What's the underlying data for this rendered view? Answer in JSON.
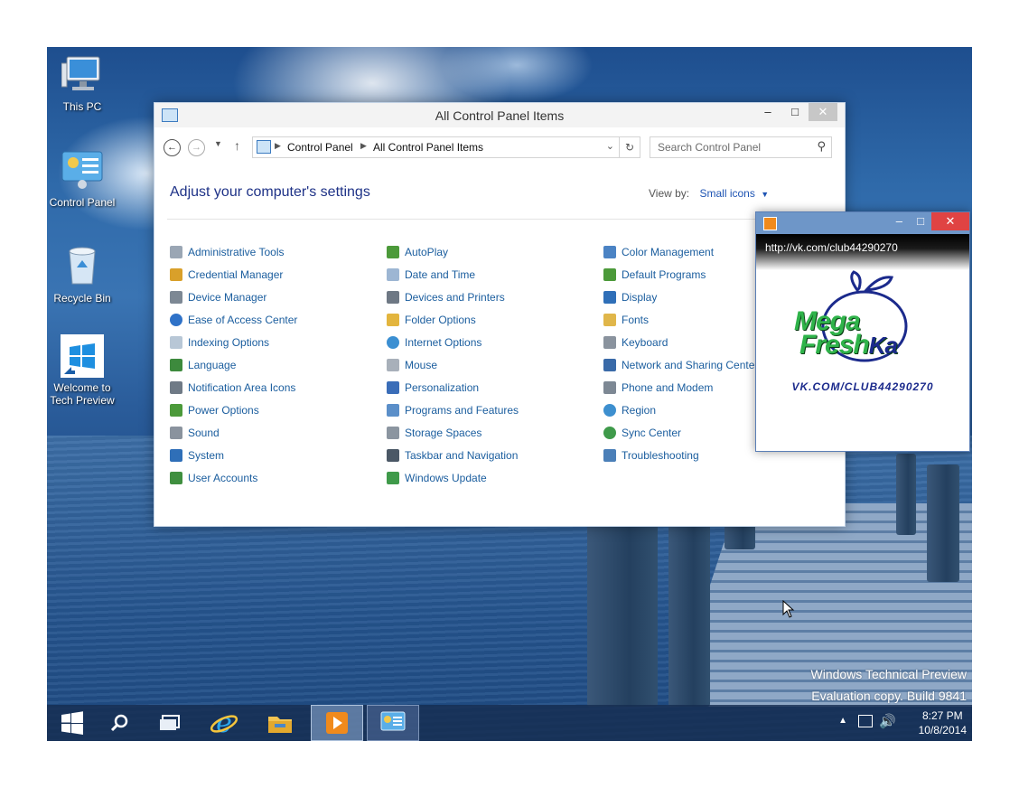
{
  "desktop": {
    "icons": [
      {
        "label": "This PC",
        "icon": "computer-icon"
      },
      {
        "label": "Control Panel",
        "icon": "control-panel-icon"
      },
      {
        "label": "Recycle Bin",
        "icon": "recycle-bin-icon"
      },
      {
        "label_line1": "Welcome to",
        "label_line2": "Tech Preview",
        "icon": "windows-logo-icon"
      }
    ],
    "watermark_line1": "Windows Technical Preview",
    "watermark_line2": "Evaluation copy. Build 9841"
  },
  "control_panel": {
    "title": "All Control Panel Items",
    "breadcrumb": [
      "Control Panel",
      "All Control Panel Items"
    ],
    "search_placeholder": "Search Control Panel",
    "heading": "Adjust your computer's settings",
    "view_by_label": "View by:",
    "view_by_value": "Small icons",
    "columns": [
      [
        "Administrative Tools",
        "Credential Manager",
        "Device Manager",
        "Ease of Access Center",
        "Indexing Options",
        "Language",
        "Notification Area Icons",
        "Power Options",
        "Sound",
        "System",
        "User Accounts"
      ],
      [
        "AutoPlay",
        "Date and Time",
        "Devices and Printers",
        "Folder Options",
        "Internet Options",
        "Mouse",
        "Personalization",
        "Programs and Features",
        "Storage Spaces",
        "Taskbar and Navigation",
        "Windows Update"
      ],
      [
        "Color Management",
        "Default Programs",
        "Display",
        "Fonts",
        "Keyboard",
        "Network and Sharing Center",
        "Phone and Modem",
        "Region",
        "Sync Center",
        "Troubleshooting"
      ]
    ],
    "colors": {
      "link": "#1a5d9e",
      "heading": "#1e3287"
    }
  },
  "media_window": {
    "url": "http://vk.com/club44290270",
    "logo_text_1": "Mega",
    "logo_text_2": "Fresh",
    "logo_text_3": "Ka",
    "logo_url": "vk.com/club44290270"
  },
  "taskbar": {
    "items": [
      "start-button",
      "search-icon",
      "task-view-icon",
      "internet-explorer-icon",
      "file-explorer-icon",
      "media-player-icon",
      "control-panel-icon"
    ],
    "time": "8:27 PM",
    "date": "10/8/2014"
  }
}
